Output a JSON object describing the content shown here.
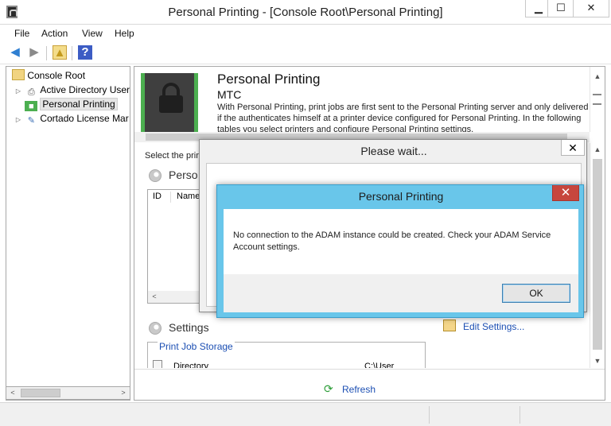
{
  "window": {
    "title": "Personal Printing - [Console Root\\Personal Printing]",
    "minimize": "▁",
    "maximize": "☐",
    "close": "✕"
  },
  "menu": [
    "File",
    "Action",
    "View",
    "Help"
  ],
  "toolbar": {
    "back": "◀",
    "forward": "▶",
    "up_folder": "▲",
    "help": "?"
  },
  "tree": {
    "items": [
      {
        "label": "Console Root",
        "expander": "",
        "icon": "folder-icon"
      },
      {
        "label": "Active Directory User",
        "expander": "▷",
        "icon": "ad-users-icon"
      },
      {
        "label": "Personal Printing",
        "expander": "",
        "icon": "lock-icon"
      },
      {
        "label": "Cortado License Mar",
        "expander": "▷",
        "icon": "license-icon"
      }
    ]
  },
  "header": {
    "title": "Personal Printing",
    "subtitle": "MTC",
    "description": "With Personal Printing, print jobs are first sent to the Personal Printing server and only delivered if the authenticates himself at a printer device configured for Personal Printing. In the following tables you select printers and configure Personal Printing settings."
  },
  "body": {
    "select_text": "Select the prin",
    "printers_heading": "Perso",
    "table_columns": [
      "ID",
      "Name"
    ],
    "settings_heading": "Settings",
    "edit_settings": "Edit Settings...",
    "storage_label": "Print Job Storage",
    "directory_label": "Directory",
    "directory_value": "C:\\User Storage",
    "refresh": "Refresh"
  },
  "wait_dialog": {
    "title": "Please wait...",
    "close": "✕"
  },
  "error_dialog": {
    "title": "Personal Printing",
    "close": "✕",
    "message": "No connection to the ADAM instance could be created. Check your ADAM Service Account settings.",
    "ok": "OK"
  },
  "colors": {
    "dialog_frame": "#69c6ea",
    "close_button": "#c7463d",
    "link": "#1c4fb3",
    "banner_accent": "#4caf50"
  }
}
